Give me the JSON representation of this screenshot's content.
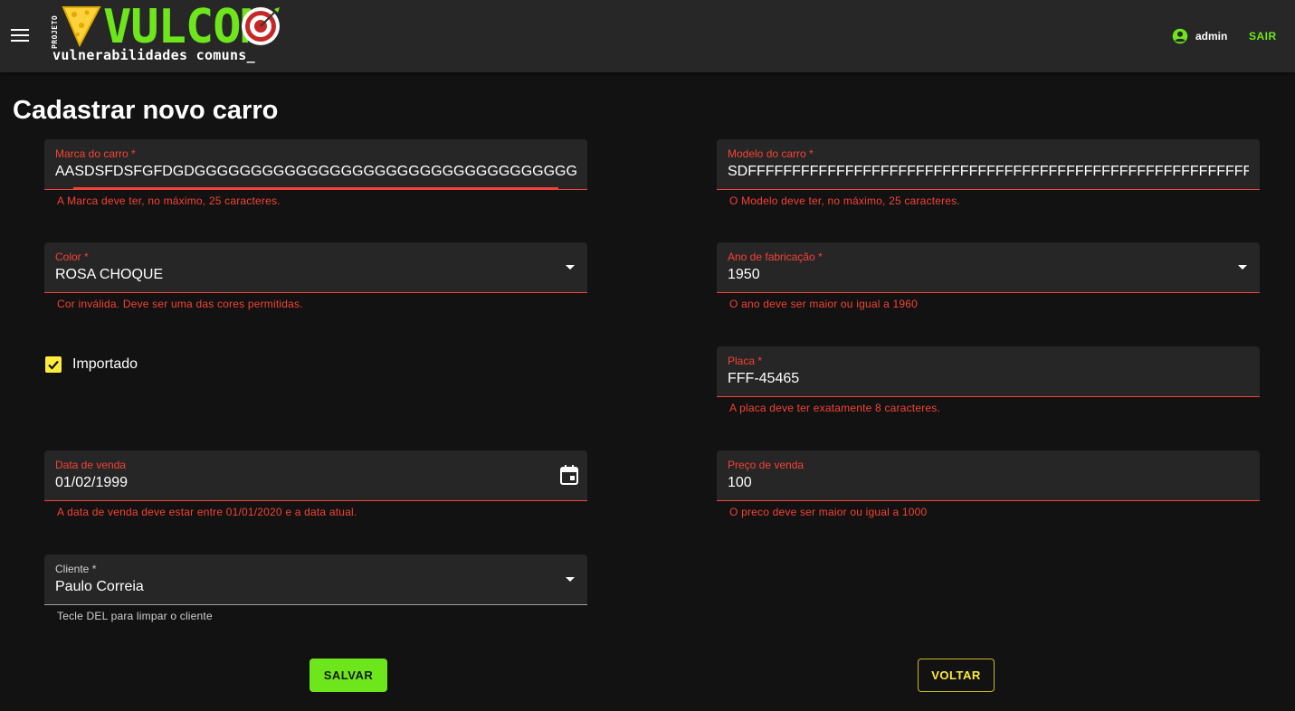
{
  "header": {
    "logo_projeto": "PROJETO",
    "logo_word": "VULCOM",
    "logo_subtitle": "vulnerabilidades comuns_",
    "user_name": "admin",
    "logout_label": "SAIR"
  },
  "page": {
    "title": "Cadastrar novo carro"
  },
  "form": {
    "marca": {
      "label": "Marca do carro *",
      "value": "AASDSFDSFGFDGDGGGGGGGGGGGGGGGGGGGGGGGGGGGGGGGGGGGGGGGGGGGG",
      "error": "A Marca deve ter, no máximo, 25 caracteres."
    },
    "modelo": {
      "label": "Modelo do carro *",
      "value": "SDFFFFFFFFFFFFFFFFFFFFFFFFFFFFFFFFFFFFFFFFFFFFFFFFFFFFFFFFFFFFFFFFFF",
      "error": "O Modelo deve ter, no máximo, 25 caracteres."
    },
    "cor": {
      "label": "Color *",
      "value": "ROSA CHOQUE",
      "error": "Cor inválida. Deve ser uma das cores permitidas."
    },
    "ano": {
      "label": "Ano de fabricação *",
      "value": "1950",
      "error": "O ano deve ser maior ou igual a 1960"
    },
    "importado": {
      "label": "Importado",
      "checked": true
    },
    "placa": {
      "label": "Placa *",
      "value": "FFF-45465",
      "error": "A placa deve ter exatamente 8 caracteres."
    },
    "data_venda": {
      "label": "Data de venda",
      "value": "01/02/1999",
      "error": "A data de venda deve estar entre 01/01/2020 e a data atual."
    },
    "preco": {
      "label": "Preço de venda",
      "value": "100",
      "error": "O preco deve ser maior ou igual a 1000"
    },
    "cliente": {
      "label": "Cliente *",
      "value": "Paulo Correia",
      "hint": "Tecle DEL para limpar o cliente"
    }
  },
  "actions": {
    "save_label": "SALVAR",
    "back_label": "VOLTAR"
  },
  "colors": {
    "accent_green": "#6ee61c",
    "accent_yellow": "#ffeb3b",
    "error_red": "#f44336",
    "background": "#121212",
    "appbar": "#272727",
    "field_bg": "#262626"
  },
  "icons": {
    "menu": "menu-icon",
    "user": "account-circle-icon",
    "dropdown": "arrow-drop-down-icon",
    "calendar": "calendar-icon",
    "checkbox": "check-icon"
  }
}
